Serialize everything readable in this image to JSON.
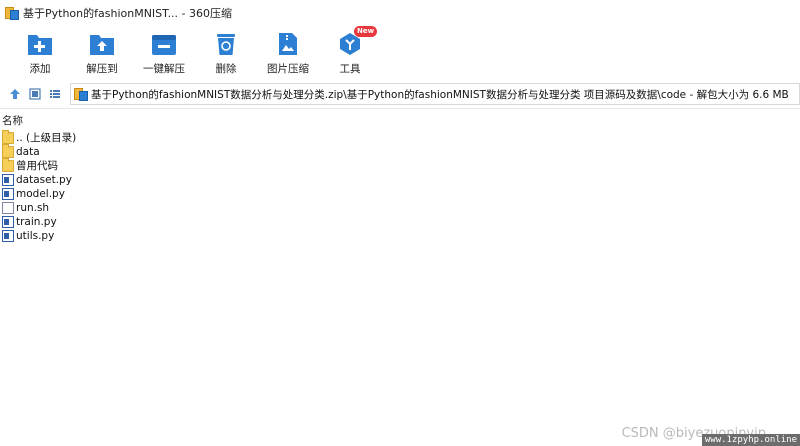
{
  "window": {
    "title": "基于Python的fashionMNIST... - 360压缩"
  },
  "toolbar": {
    "items": [
      {
        "label": "添加",
        "icon": "add-icon"
      },
      {
        "label": "解压到",
        "icon": "extract-to-icon"
      },
      {
        "label": "一键解压",
        "icon": "one-click-extract-icon"
      },
      {
        "label": "删除",
        "icon": "delete-icon"
      },
      {
        "label": "图片压缩",
        "icon": "image-compress-icon"
      },
      {
        "label": "工具",
        "icon": "tools-icon",
        "badge": "New"
      }
    ]
  },
  "address": {
    "path": "基于Python的fashionMNIST数据分析与处理分类.zip\\基于Python的fashionMNIST数据分析与处理分类 项目源码及数据\\code - 解包大小为 6.6 MB"
  },
  "list": {
    "column_name": "名称",
    "items": [
      {
        "name": ".. (上级目录)",
        "type": "folder"
      },
      {
        "name": "data",
        "type": "folder"
      },
      {
        "name": "曾用代码",
        "type": "folder"
      },
      {
        "name": "dataset.py",
        "type": "py"
      },
      {
        "name": "model.py",
        "type": "py"
      },
      {
        "name": "run.sh",
        "type": "sh"
      },
      {
        "name": "train.py",
        "type": "py"
      },
      {
        "name": "utils.py",
        "type": "py"
      }
    ]
  },
  "watermark": {
    "text": "CSDN @biyezuopinvip",
    "site": "www.1zpyhp.online"
  },
  "colors": {
    "accent": "#2d7fd3",
    "badge": "#e8383d",
    "folder": "#f6cf5b"
  }
}
